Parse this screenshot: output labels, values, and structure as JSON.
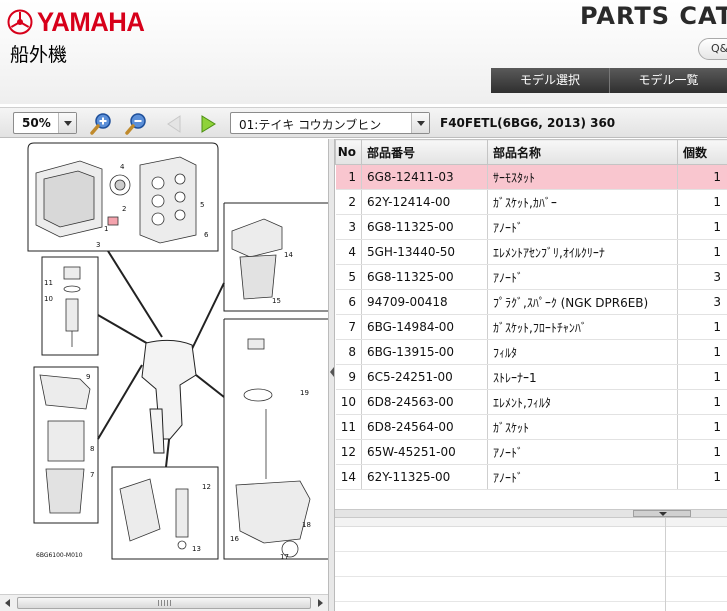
{
  "header": {
    "brand": "YAMAHA",
    "subtitle": "船外機",
    "catalog_title": "PARTS CATALOG",
    "qa_label": "Q&A",
    "nav": {
      "model_select": "モデル選択",
      "model_list": "モデル一覧"
    }
  },
  "toolbar": {
    "zoom_value": "50%",
    "page_select_value": "01:テイキ コウカンブヒン",
    "model_info": "F40FETL(6BG6, 2013) 360"
  },
  "diagram": {
    "callouts": [
      "1",
      "2",
      "3",
      "4",
      "5",
      "6",
      "7",
      "8",
      "9",
      "10",
      "11",
      "12",
      "13",
      "14",
      "15",
      "16",
      "17",
      "18",
      "19"
    ],
    "figure_code": "6BG6100-M010"
  },
  "table": {
    "headers": {
      "no": "No",
      "part_number": "部品番号",
      "part_name": "部品名称",
      "qty": "個数"
    },
    "rows": [
      {
        "no": "1",
        "part_number": "6G8-12411-03",
        "part_name": "ｻｰﾓｽﾀｯﾄ",
        "qty": "1",
        "selected": true
      },
      {
        "no": "2",
        "part_number": "62Y-12414-00",
        "part_name": "ｶﾞｽｹｯﾄ,ｶﾊﾞｰ",
        "qty": "1"
      },
      {
        "no": "3",
        "part_number": "6G8-11325-00",
        "part_name": "ｱﾉｰﾄﾞ",
        "qty": "1"
      },
      {
        "no": "4",
        "part_number": "5GH-13440-50",
        "part_name": "ｴﾚﾒﾝﾄｱｾﾝﾌﾞﾘ,ｵｲﾙｸﾘｰﾅ",
        "qty": "1"
      },
      {
        "no": "5",
        "part_number": "6G8-11325-00",
        "part_name": "ｱﾉｰﾄﾞ",
        "qty": "3"
      },
      {
        "no": "6",
        "part_number": "94709-00418",
        "part_name": "ﾌﾟﾗｸﾞ,ｽﾊﾟｰｸ (NGK DPR6EB)",
        "qty": "3"
      },
      {
        "no": "7",
        "part_number": "6BG-14984-00",
        "part_name": "ｶﾞｽｹｯﾄ,ﾌﾛｰﾄﾁｬﾝﾊﾞ",
        "qty": "1"
      },
      {
        "no": "8",
        "part_number": "6BG-13915-00",
        "part_name": "ﾌｨﾙﾀ",
        "qty": "1"
      },
      {
        "no": "9",
        "part_number": "6C5-24251-00",
        "part_name": "ｽﾄﾚｰﾅｰ1",
        "qty": "1"
      },
      {
        "no": "10",
        "part_number": "6D8-24563-00",
        "part_name": "ｴﾚﾒﾝﾄ,ﾌｨﾙﾀ",
        "qty": "1"
      },
      {
        "no": "11",
        "part_number": "6D8-24564-00",
        "part_name": "ｶﾞｽｹｯﾄ",
        "qty": "1"
      },
      {
        "no": "12",
        "part_number": "65W-45251-00",
        "part_name": "ｱﾉｰﾄﾞ",
        "qty": "1"
      },
      {
        "no": "14",
        "part_number": "62Y-11325-00",
        "part_name": "ｱﾉｰﾄﾞ",
        "qty": "1"
      }
    ]
  },
  "colors": {
    "brand_red": "#d7001a",
    "selected_row": "#f9c6cf",
    "nav_bg": "#3a3a3a"
  }
}
